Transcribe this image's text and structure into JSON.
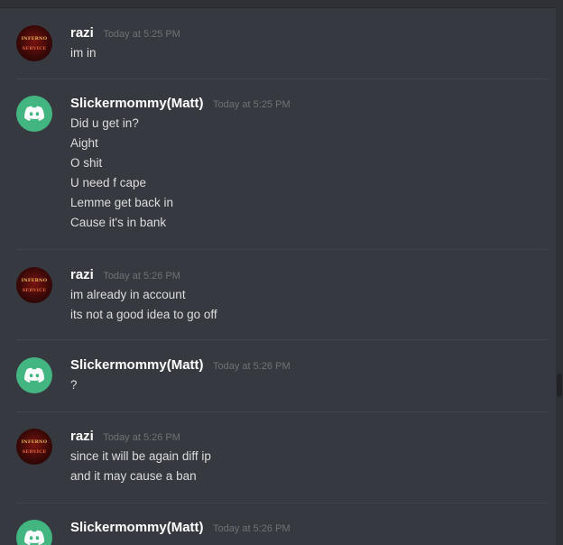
{
  "timestamps": {
    "t525": "Today at 5:25 PM",
    "t526": "Today at 5:26 PM"
  },
  "users": {
    "razi": "razi",
    "matt": "Slickermommy(Matt)"
  },
  "avatar_text": {
    "line1": "INFERNO",
    "line2": "SERVICE"
  },
  "messages": [
    {
      "author": "razi",
      "time": "Today at 5:25 PM",
      "lines": [
        "im in"
      ]
    },
    {
      "author": "Slickermommy(Matt)",
      "time": "Today at 5:25 PM",
      "lines": [
        "Did u get in?",
        "Aight",
        "O shit",
        "U need f cape",
        "Lemme get back in",
        "Cause it's in bank"
      ]
    },
    {
      "author": "razi",
      "time": "Today at 5:26 PM",
      "lines": [
        "im already in account",
        "its not a good idea to go off"
      ]
    },
    {
      "author": "Slickermommy(Matt)",
      "time": "Today at 5:26 PM",
      "lines": [
        "?"
      ]
    },
    {
      "author": "razi",
      "time": "Today at 5:26 PM",
      "lines": [
        "since it will be again diff ip",
        "and it may cause a ban"
      ]
    },
    {
      "author": "Slickermommy(Matt)",
      "time": "Today at 5:26 PM",
      "lines": []
    }
  ],
  "colors": {
    "background": "#36393f",
    "discord_avatar": "#43b581",
    "username": "#ffffff",
    "text": "#dcddde",
    "timestamp": "#6f7377"
  }
}
